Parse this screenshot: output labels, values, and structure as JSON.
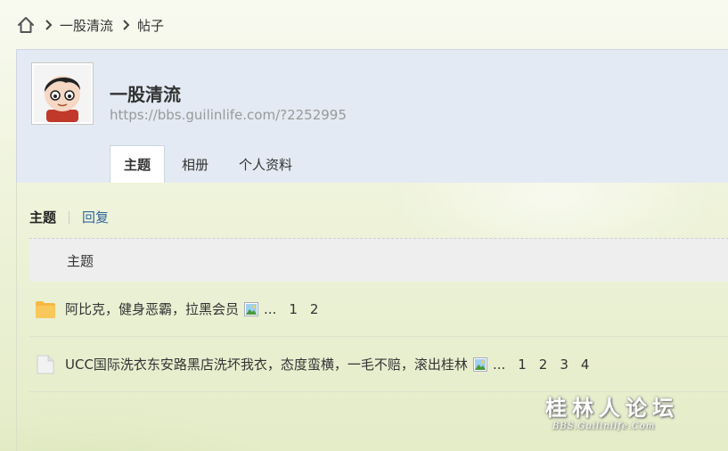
{
  "breadcrumb": {
    "home_icon": "home-icon",
    "items": [
      "一股清流",
      "帖子"
    ]
  },
  "profile": {
    "name": "一股清流",
    "url": "https://bbs.guilinlife.com/?2252995",
    "tabs": [
      {
        "label": "主题",
        "active": true
      },
      {
        "label": "相册",
        "active": false
      },
      {
        "label": "个人资料",
        "active": false
      }
    ]
  },
  "subtabs": {
    "current": "主题",
    "other": "回复"
  },
  "table": {
    "header": "主题",
    "rows": [
      {
        "icon": "folder-icon",
        "title": "阿比克，健身恶霸，拉黑会员",
        "dots": "...",
        "pages": [
          "1",
          "2"
        ]
      },
      {
        "icon": "document-icon",
        "title": "UCC国际洗衣东安路黑店洗坏我衣，态度蛮横，一毛不赔，滚出桂林",
        "dots": "...",
        "pages": [
          "1",
          "2",
          "3",
          "4"
        ]
      }
    ]
  },
  "watermark": {
    "line1": "桂林人论坛",
    "line2": "BBS.Guilinlife.Com"
  },
  "colors": {
    "profile_bg": "#e3eaf3",
    "link": "#336699",
    "folder": "#f5b843"
  }
}
